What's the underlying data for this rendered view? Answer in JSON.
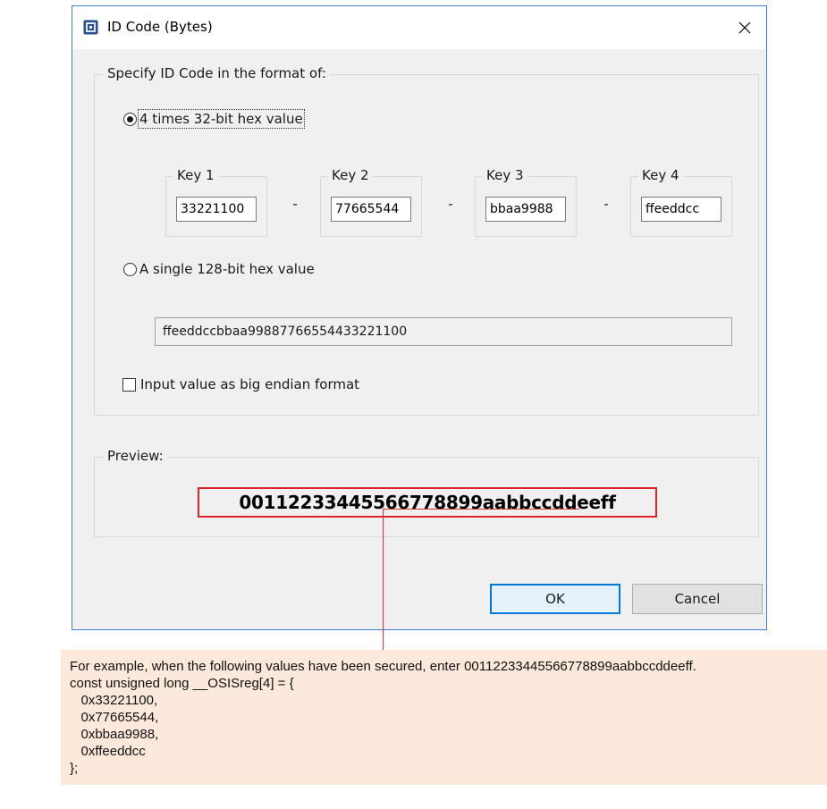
{
  "dialog": {
    "title": "ID Code (Bytes)",
    "close_glyph": "✕",
    "format_group_label": "Specify ID Code in the format of:",
    "option_four_keys": {
      "label": "4 times 32-bit hex value",
      "selected": true
    },
    "keys": [
      {
        "label": "Key 1",
        "value": "33221100"
      },
      {
        "label": "Key 2",
        "value": "77665544"
      },
      {
        "label": "Key 3",
        "value": "bbaa9988"
      },
      {
        "label": "Key 4",
        "value": "ffeeddcc"
      }
    ],
    "key_separator": "-",
    "option_single": {
      "label": "A single 128-bit hex value",
      "selected": false
    },
    "single_value": "ffeeddccbbaa99887766554433221100",
    "big_endian": {
      "label": "Input value as big endian format",
      "checked": false
    },
    "preview_label": "Preview:",
    "preview_value": "00112233445566778899aabbccddeeff",
    "ok_label": "OK",
    "cancel_label": "Cancel"
  },
  "note": {
    "lines": [
      "For example, when the following values have been secured, enter 00112233445566778899aabbccddeeff.",
      "const unsigned long __OSISreg[4] = {",
      "   0x33221100,",
      "   0x77665544,",
      "   0xbbaa9988,",
      "   0xffeeddcc",
      "};"
    ]
  },
  "colors": {
    "highlight_red": "#e0242a",
    "note_background": "#fce9dc",
    "window_border": "#3c7fd1",
    "default_button_border": "#0078d7"
  }
}
